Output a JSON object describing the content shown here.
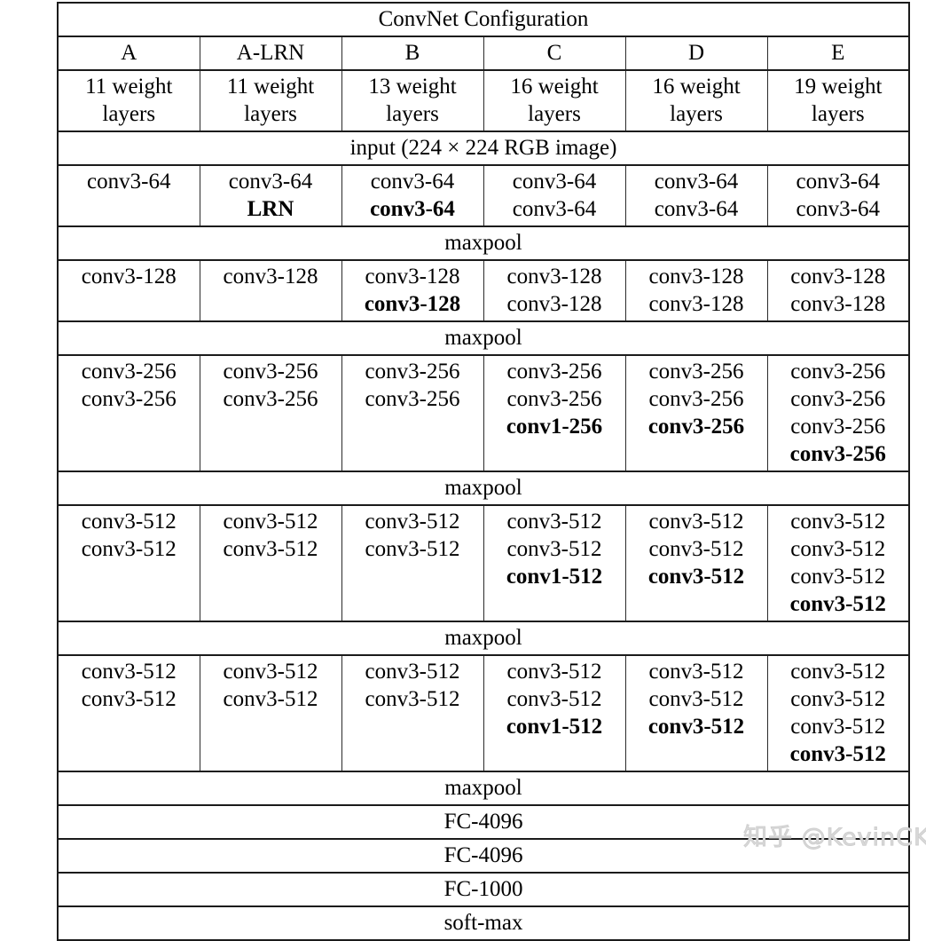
{
  "table": {
    "title": "ConvNet Configuration",
    "columns": [
      {
        "name": "A",
        "layers": "11 weight\nlayers"
      },
      {
        "name": "A-LRN",
        "layers": "11 weight\nlayers"
      },
      {
        "name": "B",
        "layers": "13 weight\nlayers"
      },
      {
        "name": "C",
        "layers": "16 weight\nlayers"
      },
      {
        "name": "D",
        "layers": "16 weight\nlayers"
      },
      {
        "name": "E",
        "layers": "19 weight\nlayers"
      }
    ],
    "column_letters": [
      "A",
      "A-LRN",
      "B",
      "C",
      "D",
      "E"
    ],
    "column_layer_counts": [
      "11 weight layers",
      "11 weight layers",
      "13 weight layers",
      "16 weight layers",
      "16 weight layers",
      "19 weight layers"
    ],
    "input_row": "input (224 × 224 RGB image)",
    "maxpool_label": "maxpool",
    "fc_rows": [
      "FC-4096",
      "FC-4096",
      "FC-1000"
    ],
    "softmax_row": "soft-max",
    "blocks": [
      {
        "id": "block-64",
        "cells": [
          [
            {
              "text": "conv3-64",
              "bold": false
            }
          ],
          [
            {
              "text": "conv3-64",
              "bold": false
            },
            {
              "text": "LRN",
              "bold": true
            }
          ],
          [
            {
              "text": "conv3-64",
              "bold": false
            },
            {
              "text": "conv3-64",
              "bold": true
            }
          ],
          [
            {
              "text": "conv3-64",
              "bold": false
            },
            {
              "text": "conv3-64",
              "bold": false
            }
          ],
          [
            {
              "text": "conv3-64",
              "bold": false
            },
            {
              "text": "conv3-64",
              "bold": false
            }
          ],
          [
            {
              "text": "conv3-64",
              "bold": false
            },
            {
              "text": "conv3-64",
              "bold": false
            }
          ]
        ]
      },
      {
        "id": "block-128",
        "cells": [
          [
            {
              "text": "conv3-128",
              "bold": false
            }
          ],
          [
            {
              "text": "conv3-128",
              "bold": false
            }
          ],
          [
            {
              "text": "conv3-128",
              "bold": false
            },
            {
              "text": "conv3-128",
              "bold": true
            }
          ],
          [
            {
              "text": "conv3-128",
              "bold": false
            },
            {
              "text": "conv3-128",
              "bold": false
            }
          ],
          [
            {
              "text": "conv3-128",
              "bold": false
            },
            {
              "text": "conv3-128",
              "bold": false
            }
          ],
          [
            {
              "text": "conv3-128",
              "bold": false
            },
            {
              "text": "conv3-128",
              "bold": false
            }
          ]
        ]
      },
      {
        "id": "block-256",
        "cells": [
          [
            {
              "text": "conv3-256",
              "bold": false
            },
            {
              "text": "conv3-256",
              "bold": false
            }
          ],
          [
            {
              "text": "conv3-256",
              "bold": false
            },
            {
              "text": "conv3-256",
              "bold": false
            }
          ],
          [
            {
              "text": "conv3-256",
              "bold": false
            },
            {
              "text": "conv3-256",
              "bold": false
            }
          ],
          [
            {
              "text": "conv3-256",
              "bold": false
            },
            {
              "text": "conv3-256",
              "bold": false
            },
            {
              "text": "conv1-256",
              "bold": true
            }
          ],
          [
            {
              "text": "conv3-256",
              "bold": false
            },
            {
              "text": "conv3-256",
              "bold": false
            },
            {
              "text": "conv3-256",
              "bold": true
            }
          ],
          [
            {
              "text": "conv3-256",
              "bold": false
            },
            {
              "text": "conv3-256",
              "bold": false
            },
            {
              "text": "conv3-256",
              "bold": false
            },
            {
              "text": "conv3-256",
              "bold": true
            }
          ]
        ]
      },
      {
        "id": "block-512-a",
        "cells": [
          [
            {
              "text": "conv3-512",
              "bold": false
            },
            {
              "text": "conv3-512",
              "bold": false
            }
          ],
          [
            {
              "text": "conv3-512",
              "bold": false
            },
            {
              "text": "conv3-512",
              "bold": false
            }
          ],
          [
            {
              "text": "conv3-512",
              "bold": false
            },
            {
              "text": "conv3-512",
              "bold": false
            }
          ],
          [
            {
              "text": "conv3-512",
              "bold": false
            },
            {
              "text": "conv3-512",
              "bold": false
            },
            {
              "text": "conv1-512",
              "bold": true
            }
          ],
          [
            {
              "text": "conv3-512",
              "bold": false
            },
            {
              "text": "conv3-512",
              "bold": false
            },
            {
              "text": "conv3-512",
              "bold": true
            }
          ],
          [
            {
              "text": "conv3-512",
              "bold": false
            },
            {
              "text": "conv3-512",
              "bold": false
            },
            {
              "text": "conv3-512",
              "bold": false
            },
            {
              "text": "conv3-512",
              "bold": true
            }
          ]
        ]
      },
      {
        "id": "block-512-b",
        "cells": [
          [
            {
              "text": "conv3-512",
              "bold": false
            },
            {
              "text": "conv3-512",
              "bold": false
            }
          ],
          [
            {
              "text": "conv3-512",
              "bold": false
            },
            {
              "text": "conv3-512",
              "bold": false
            }
          ],
          [
            {
              "text": "conv3-512",
              "bold": false
            },
            {
              "text": "conv3-512",
              "bold": false
            }
          ],
          [
            {
              "text": "conv3-512",
              "bold": false
            },
            {
              "text": "conv3-512",
              "bold": false
            },
            {
              "text": "conv1-512",
              "bold": true
            }
          ],
          [
            {
              "text": "conv3-512",
              "bold": false
            },
            {
              "text": "conv3-512",
              "bold": false
            },
            {
              "text": "conv3-512",
              "bold": true
            }
          ],
          [
            {
              "text": "conv3-512",
              "bold": false
            },
            {
              "text": "conv3-512",
              "bold": false
            },
            {
              "text": "conv3-512",
              "bold": false
            },
            {
              "text": "conv3-512",
              "bold": true
            }
          ]
        ]
      }
    ]
  },
  "watermark": {
    "text": "知乎 @KevinCK",
    "color": "#d9d9d9"
  }
}
